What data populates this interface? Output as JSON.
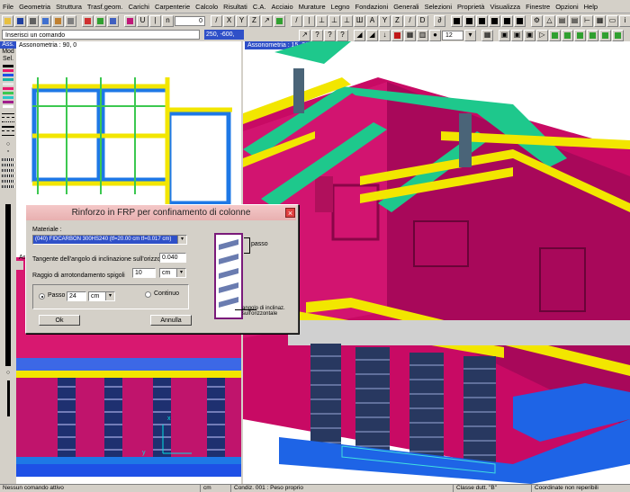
{
  "menu": [
    "File",
    "Geometria",
    "Struttura",
    "Trasf.geom.",
    "Carichi",
    "Carpenterie",
    "Calcolo",
    "Risultati",
    "C.A.",
    "Acciaio",
    "Murature",
    "Legno",
    "Fondazioni",
    "Generali",
    "Selezioni",
    "Proprietà",
    "Visualizza",
    "Finestre",
    "Opzioni",
    "Help"
  ],
  "toolbar": {
    "spin_value": "12",
    "input_value": "0"
  },
  "command": {
    "placeholder": "Inserisci un comando",
    "coords": "250, -600, 1250"
  },
  "palette": {
    "ass": "Ass.",
    "mod": "Mod",
    "sel": "Sel.",
    "colors": [
      "#000000",
      "#e8186e",
      "#1e50e6",
      "#18b4a0",
      "#e8e8e8",
      "#e8186e",
      "#3cc850",
      "#28c8c8",
      "#a01e8c",
      "#ffffff"
    ]
  },
  "left_view": {
    "label": "Assonometria :  90, 0",
    "label2": "Ass",
    "axis_x": "x",
    "axis_y": "y"
  },
  "right_view": {
    "label": "Assonometria :  15, 38"
  },
  "dialog": {
    "title": "Rinforzo in FRP per confinamento di colonne",
    "material_label": "Materiale :",
    "material_value": "(040)  FIDCARBON 300HS240  (tf=20.00 cm  tf=0.017 cm)",
    "tan_label": "Tangente dell'angolo di inclinazione sull'orizzontale",
    "tan_value": "0.040",
    "radius_label": "Raggio di arrotondamento spigoli",
    "radius_value": "10",
    "radius_unit": "cm",
    "passo_label": "Passo",
    "passo_value": "24",
    "passo_unit": "cm",
    "continuo_label": "Continuo",
    "ok_label": "Ok",
    "cancel_label": "Annulla",
    "fig_passo": "passo",
    "fig_angle": "angolo di inclinaz. sull'orizzontale"
  },
  "status": {
    "s1": "Nessun comando attivo",
    "s2": "cm",
    "s3": "Condiz. 001 : Peso proprio",
    "s4": "Classe dutt. \"B\"",
    "s5": "Coordinate non reperibili"
  }
}
